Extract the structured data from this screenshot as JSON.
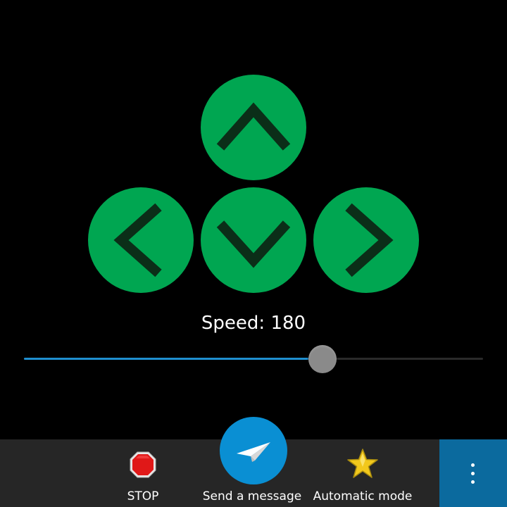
{
  "controls": {
    "up_icon": "chevron-up-icon",
    "left_icon": "chevron-left-icon",
    "down_icon": "chevron-down-icon",
    "right_icon": "chevron-right-icon",
    "button_color": "#00a651",
    "arrow_color": "#0b2e18"
  },
  "speed": {
    "label": "Speed: 180",
    "value": 180,
    "slider_fraction": 0.651,
    "fill_color": "#1f8fd0",
    "thumb_color": "#8a8a8a"
  },
  "action_bar": {
    "stop": {
      "label": "STOP",
      "icon": "stop-sign-icon"
    },
    "send": {
      "label": "Send a message",
      "icon": "paper-plane-icon",
      "color": "#0a8fd3"
    },
    "auto": {
      "label": "Automatic mode",
      "icon": "star-icon"
    },
    "overflow": {
      "icon": "more-vertical-icon",
      "color": "#0b6a9e"
    }
  }
}
